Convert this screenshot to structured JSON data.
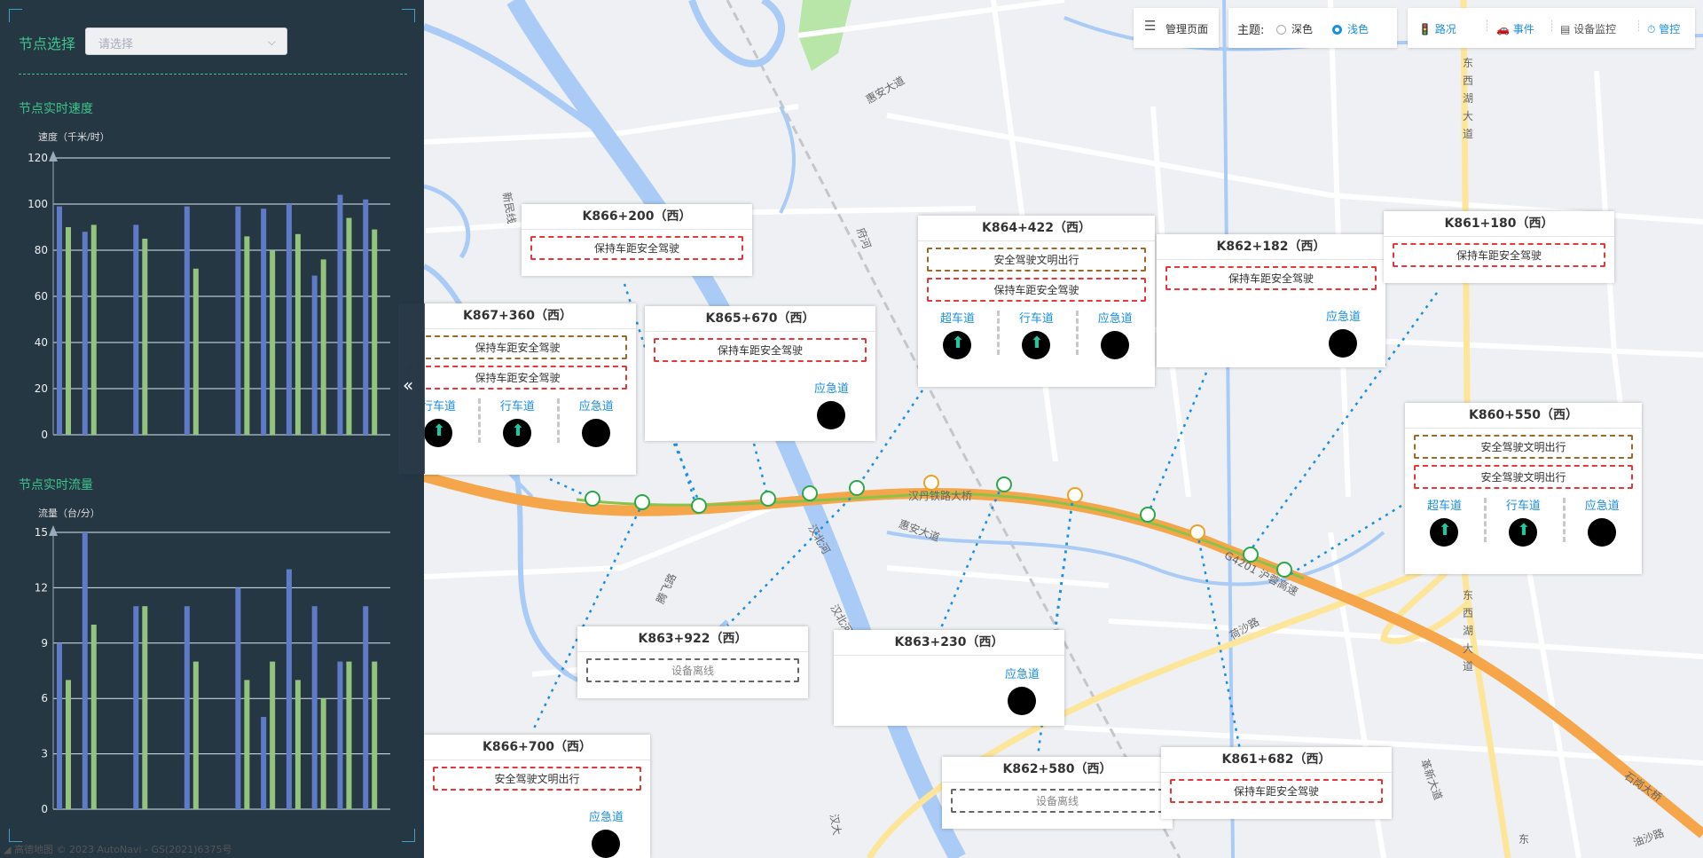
{
  "map": {
    "labels": [
      {
        "t": "惠安大道",
        "x": 1000,
        "y": 105,
        "r": -30
      },
      {
        "t": "东",
        "x": 1655,
        "y": 75
      },
      {
        "t": "西",
        "x": 1655,
        "y": 95
      },
      {
        "t": "湖",
        "x": 1655,
        "y": 115
      },
      {
        "t": "大",
        "x": 1655,
        "y": 135
      },
      {
        "t": "道",
        "x": 1655,
        "y": 155
      },
      {
        "t": "东",
        "x": 1655,
        "y": 675
      },
      {
        "t": "西",
        "x": 1655,
        "y": 695
      },
      {
        "t": "湖",
        "x": 1655,
        "y": 715
      },
      {
        "t": "大",
        "x": 1655,
        "y": 735
      },
      {
        "t": "道",
        "x": 1655,
        "y": 755
      },
      {
        "t": "新民线",
        "x": 570,
        "y": 235,
        "r": 80
      },
      {
        "t": "汉丹铁路大桥",
        "x": 1060,
        "y": 563,
        "r": 0
      },
      {
        "t": "惠安大道",
        "x": 1035,
        "y": 602,
        "r": 20
      },
      {
        "t": "G4201 沪蓉高速",
        "x": 1420,
        "y": 650,
        "r": 28
      },
      {
        "t": "荷沙路",
        "x": 1405,
        "y": 712,
        "r": -30
      },
      {
        "t": "汉北河",
        "x": 920,
        "y": 610,
        "r": 60
      },
      {
        "t": "汉北河",
        "x": 945,
        "y": 700,
        "r": 60
      },
      {
        "t": "府河",
        "x": 970,
        "y": 270,
        "r": 70
      },
      {
        "t": "腾飞路",
        "x": 755,
        "y": 665,
        "r": -65
      },
      {
        "t": "革新大道",
        "x": 1610,
        "y": 880,
        "r": 70
      },
      {
        "t": "石岗大桥",
        "x": 1850,
        "y": 890,
        "r": 35
      },
      {
        "t": "油沙路",
        "x": 1860,
        "y": 948,
        "r": -20
      },
      {
        "t": "东",
        "x": 1718,
        "y": 950,
        "r": 0
      },
      {
        "t": "汉大",
        "x": 938,
        "y": 930,
        "r": 80
      }
    ]
  },
  "panel": {
    "node_select_label": "节点选择",
    "node_select_placeholder": "请选择",
    "speed_title": "节点实时速度",
    "speed_unit": "速度（千米/时）",
    "flow_title": "节点实时流量",
    "flow_unit": "流量（台/分）",
    "collapse_label": "«"
  },
  "chart_data": [
    {
      "type": "bar",
      "title": "节点实时速度",
      "ylabel": "速度（千米/时）",
      "ylim": [
        0,
        120
      ],
      "yticks": [
        0,
        20,
        40,
        60,
        80,
        100,
        120
      ],
      "grid": true,
      "colors": [
        "#5f7bc8",
        "#93c47d"
      ],
      "series": [
        {
          "values": [
            99,
            88,
            0,
            91,
            0,
            99,
            0,
            99,
            98,
            100,
            69,
            104,
            102
          ]
        },
        {
          "values": [
            90,
            91,
            0,
            85,
            0,
            72,
            0,
            86,
            80,
            87,
            76,
            94,
            89
          ]
        }
      ]
    },
    {
      "type": "bar",
      "title": "节点实时流量",
      "ylabel": "流量（台/分）",
      "ylim": [
        0,
        15
      ],
      "yticks": [
        0,
        3,
        6,
        9,
        12,
        15
      ],
      "grid": true,
      "colors": [
        "#5f7bc8",
        "#93c47d"
      ],
      "series": [
        {
          "values": [
            9,
            15,
            0,
            11,
            0,
            11,
            0,
            12,
            5,
            13,
            11,
            8,
            11
          ]
        },
        {
          "values": [
            7,
            10,
            0,
            11,
            0,
            8,
            0,
            7,
            8,
            7,
            6,
            8,
            8
          ]
        }
      ]
    }
  ],
  "toolbar": {
    "manage": "管理页面",
    "theme_label": "主题:",
    "theme_dark": "深色",
    "theme_light": "浅色",
    "road": "路况",
    "event": "事件",
    "device": "设备监控",
    "control": "管控"
  },
  "attribution": "◢ 高德地图  © 2023 AutoNavi - GS(2021)6375号",
  "cards": [
    {
      "title": "K866+200（西）",
      "msgs": [
        {
          "t": "保持车距安全驾驶",
          "c": "red"
        }
      ]
    },
    {
      "title": "K867+360（西）",
      "msgs": [
        {
          "t": "保持车距安全驾驶",
          "c": "brown"
        },
        {
          "t": "保持车距安全驾驶",
          "c": "red"
        }
      ],
      "lanes": [
        "行车道",
        "行车道",
        "应急道"
      ]
    },
    {
      "title": "K865+670（西）",
      "msgs": [
        {
          "t": "保持车距安全驾驶",
          "c": "red"
        }
      ],
      "single": "应急道"
    },
    {
      "title": "K864+422（西）",
      "msgs": [
        {
          "t": "安全驾驶文明出行",
          "c": "brown"
        },
        {
          "t": "保持车距安全驾驶",
          "c": "red"
        }
      ],
      "lanes": [
        "超车道",
        "行车道",
        "应急道"
      ]
    },
    {
      "title": "K862+182（西）",
      "msgs": [
        {
          "t": "保持车距安全驾驶",
          "c": "red"
        }
      ],
      "single": "应急道"
    },
    {
      "title": "K861+180（西）",
      "msgs": [
        {
          "t": "保持车距安全驾驶",
          "c": "red"
        }
      ]
    },
    {
      "title": "K860+550（西）",
      "msgs": [
        {
          "t": "安全驾驶文明出行",
          "c": "brown"
        },
        {
          "t": "安全驾驶文明出行",
          "c": "red"
        }
      ],
      "lanes": [
        "超车道",
        "行车道",
        "应急道"
      ]
    },
    {
      "title": "K863+922（西）",
      "msgs": [
        {
          "t": "设备离线",
          "c": "gray"
        }
      ]
    },
    {
      "title": "K863+230（西）",
      "msgs": [],
      "single": "应急道"
    },
    {
      "title": "K866+700（西）",
      "msgs": [
        {
          "t": "安全驾驶文明出行",
          "c": "red"
        }
      ],
      "single": "应急道"
    },
    {
      "title": "K862+580（西）",
      "msgs": [
        {
          "t": "设备离线",
          "c": "gray"
        }
      ]
    },
    {
      "title": "K861+682（西）",
      "msgs": [
        {
          "t": "保持车距安全驾驶",
          "c": "red"
        }
      ]
    }
  ]
}
